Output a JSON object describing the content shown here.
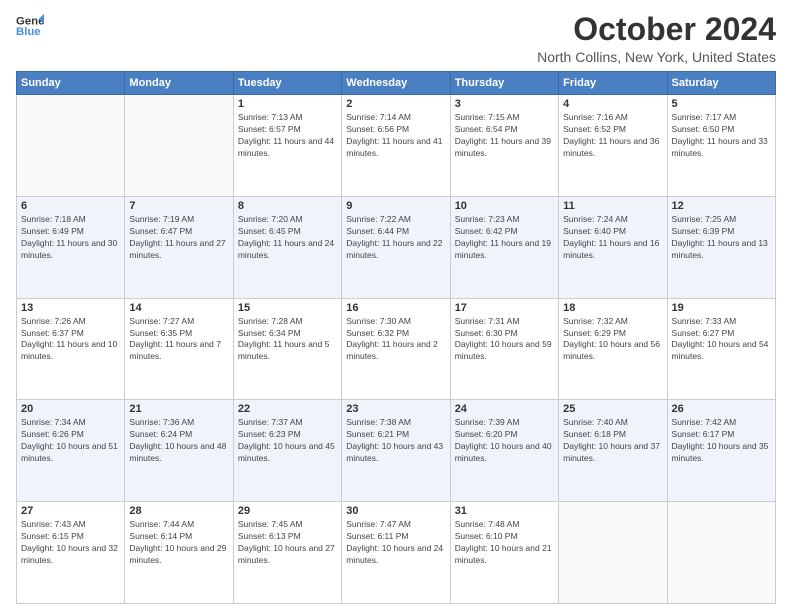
{
  "header": {
    "logo_line1": "General",
    "logo_line2": "Blue",
    "title": "October 2024",
    "subtitle": "North Collins, New York, United States"
  },
  "columns": [
    "Sunday",
    "Monday",
    "Tuesday",
    "Wednesday",
    "Thursday",
    "Friday",
    "Saturday"
  ],
  "weeks": [
    [
      {
        "day": "",
        "info": ""
      },
      {
        "day": "",
        "info": ""
      },
      {
        "day": "1",
        "info": "Sunrise: 7:13 AM\nSunset: 6:57 PM\nDaylight: 11 hours and 44 minutes."
      },
      {
        "day": "2",
        "info": "Sunrise: 7:14 AM\nSunset: 6:56 PM\nDaylight: 11 hours and 41 minutes."
      },
      {
        "day": "3",
        "info": "Sunrise: 7:15 AM\nSunset: 6:54 PM\nDaylight: 11 hours and 39 minutes."
      },
      {
        "day": "4",
        "info": "Sunrise: 7:16 AM\nSunset: 6:52 PM\nDaylight: 11 hours and 36 minutes."
      },
      {
        "day": "5",
        "info": "Sunrise: 7:17 AM\nSunset: 6:50 PM\nDaylight: 11 hours and 33 minutes."
      }
    ],
    [
      {
        "day": "6",
        "info": "Sunrise: 7:18 AM\nSunset: 6:49 PM\nDaylight: 11 hours and 30 minutes."
      },
      {
        "day": "7",
        "info": "Sunrise: 7:19 AM\nSunset: 6:47 PM\nDaylight: 11 hours and 27 minutes."
      },
      {
        "day": "8",
        "info": "Sunrise: 7:20 AM\nSunset: 6:45 PM\nDaylight: 11 hours and 24 minutes."
      },
      {
        "day": "9",
        "info": "Sunrise: 7:22 AM\nSunset: 6:44 PM\nDaylight: 11 hours and 22 minutes."
      },
      {
        "day": "10",
        "info": "Sunrise: 7:23 AM\nSunset: 6:42 PM\nDaylight: 11 hours and 19 minutes."
      },
      {
        "day": "11",
        "info": "Sunrise: 7:24 AM\nSunset: 6:40 PM\nDaylight: 11 hours and 16 minutes."
      },
      {
        "day": "12",
        "info": "Sunrise: 7:25 AM\nSunset: 6:39 PM\nDaylight: 11 hours and 13 minutes."
      }
    ],
    [
      {
        "day": "13",
        "info": "Sunrise: 7:26 AM\nSunset: 6:37 PM\nDaylight: 11 hours and 10 minutes."
      },
      {
        "day": "14",
        "info": "Sunrise: 7:27 AM\nSunset: 6:35 PM\nDaylight: 11 hours and 7 minutes."
      },
      {
        "day": "15",
        "info": "Sunrise: 7:28 AM\nSunset: 6:34 PM\nDaylight: 11 hours and 5 minutes."
      },
      {
        "day": "16",
        "info": "Sunrise: 7:30 AM\nSunset: 6:32 PM\nDaylight: 11 hours and 2 minutes."
      },
      {
        "day": "17",
        "info": "Sunrise: 7:31 AM\nSunset: 6:30 PM\nDaylight: 10 hours and 59 minutes."
      },
      {
        "day": "18",
        "info": "Sunrise: 7:32 AM\nSunset: 6:29 PM\nDaylight: 10 hours and 56 minutes."
      },
      {
        "day": "19",
        "info": "Sunrise: 7:33 AM\nSunset: 6:27 PM\nDaylight: 10 hours and 54 minutes."
      }
    ],
    [
      {
        "day": "20",
        "info": "Sunrise: 7:34 AM\nSunset: 6:26 PM\nDaylight: 10 hours and 51 minutes."
      },
      {
        "day": "21",
        "info": "Sunrise: 7:36 AM\nSunset: 6:24 PM\nDaylight: 10 hours and 48 minutes."
      },
      {
        "day": "22",
        "info": "Sunrise: 7:37 AM\nSunset: 6:23 PM\nDaylight: 10 hours and 45 minutes."
      },
      {
        "day": "23",
        "info": "Sunrise: 7:38 AM\nSunset: 6:21 PM\nDaylight: 10 hours and 43 minutes."
      },
      {
        "day": "24",
        "info": "Sunrise: 7:39 AM\nSunset: 6:20 PM\nDaylight: 10 hours and 40 minutes."
      },
      {
        "day": "25",
        "info": "Sunrise: 7:40 AM\nSunset: 6:18 PM\nDaylight: 10 hours and 37 minutes."
      },
      {
        "day": "26",
        "info": "Sunrise: 7:42 AM\nSunset: 6:17 PM\nDaylight: 10 hours and 35 minutes."
      }
    ],
    [
      {
        "day": "27",
        "info": "Sunrise: 7:43 AM\nSunset: 6:15 PM\nDaylight: 10 hours and 32 minutes."
      },
      {
        "day": "28",
        "info": "Sunrise: 7:44 AM\nSunset: 6:14 PM\nDaylight: 10 hours and 29 minutes."
      },
      {
        "day": "29",
        "info": "Sunrise: 7:45 AM\nSunset: 6:13 PM\nDaylight: 10 hours and 27 minutes."
      },
      {
        "day": "30",
        "info": "Sunrise: 7:47 AM\nSunset: 6:11 PM\nDaylight: 10 hours and 24 minutes."
      },
      {
        "day": "31",
        "info": "Sunrise: 7:48 AM\nSunset: 6:10 PM\nDaylight: 10 hours and 21 minutes."
      },
      {
        "day": "",
        "info": ""
      },
      {
        "day": "",
        "info": ""
      }
    ]
  ]
}
